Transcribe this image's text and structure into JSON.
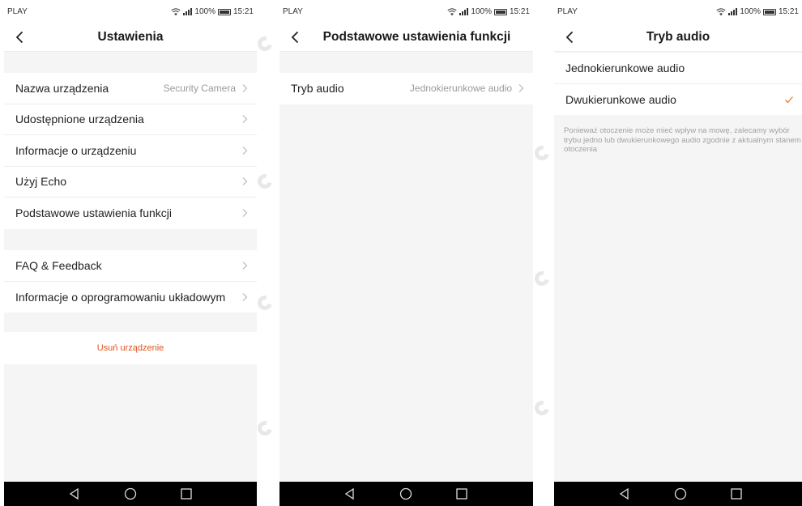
{
  "status_bar": {
    "carrier": "PLAY",
    "battery": "100%",
    "time": "15:21"
  },
  "screen1": {
    "title": "Ustawienia",
    "group1": [
      {
        "label": "Nazwa urządzenia",
        "value": "Security Camera"
      },
      {
        "label": "Udostępnione urządzenia"
      },
      {
        "label": "Informacje o urządzeniu"
      },
      {
        "label": "Użyj Echo"
      },
      {
        "label": "Podstawowe ustawienia funkcji"
      }
    ],
    "group2": [
      {
        "label": "FAQ & Feedback"
      },
      {
        "label": "Informacje o oprogramowaniu układowym"
      }
    ],
    "delete_label": "Usuń urządzenie"
  },
  "screen2": {
    "title": "Podstawowe ustawienia funkcji",
    "rows": [
      {
        "label": "Tryb audio",
        "value": "Jednokierunkowe audio"
      }
    ]
  },
  "screen3": {
    "title": "Tryb audio",
    "options": [
      {
        "label": "Jednokierunkowe audio",
        "selected": false
      },
      {
        "label": "Dwukierunkowe audio",
        "selected": true
      }
    ],
    "note": "Ponieważ otoczenie może mieć wpływ na mowę, zalecamy wybór trybu jedno lub dwukierunkowego audio zgodnie z aktualnym stanem otoczenia"
  },
  "colors": {
    "accent": "#e2531e",
    "check": "#f07a2e",
    "background": "#f5f5f5"
  },
  "icons": [
    "back-chevron-icon",
    "chevron-right-icon",
    "checkmark-icon",
    "wifi-icon",
    "signal-icon",
    "battery-icon",
    "nav-back-icon",
    "nav-home-icon",
    "nav-recents-icon"
  ]
}
